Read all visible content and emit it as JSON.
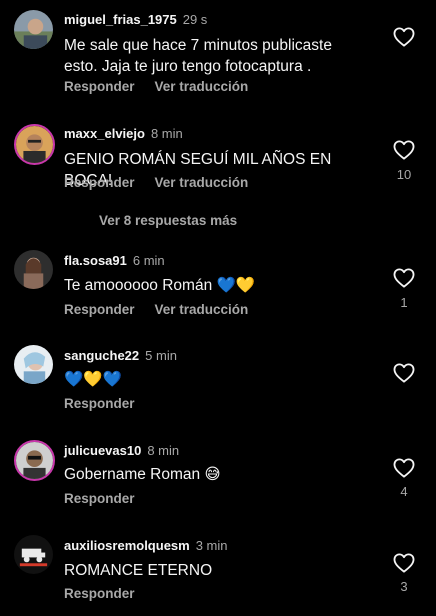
{
  "actions": {
    "reply_label": "Responder",
    "translate_label": "Ver traducción"
  },
  "comments": [
    {
      "username": "miguel_frias_1975",
      "time": "29 s",
      "text": "Me sale que hace 7 minutos publicaste esto. Jaja te juro tengo fotocaptura .",
      "likes": ""
    },
    {
      "username": "maxx_elviejo",
      "time": "8 min",
      "text": "GENIO ROMÁN SEGUÍ MIL AÑOS EN BOCA!",
      "likes": "10"
    },
    {
      "username": "fla.sosa91",
      "time": "6 min",
      "text": "Te amoooooo Román 💙💛",
      "likes": "1"
    },
    {
      "username": "sanguche22",
      "time": "5 min",
      "text": "💙💛💙",
      "likes": ""
    },
    {
      "username": "julicuevas10",
      "time": "8 min",
      "text": "Gobername Roman 😅",
      "likes": "4"
    },
    {
      "username": "auxiliosremolquesm",
      "time": "3 min",
      "text": "ROMANCE ETERNO",
      "likes": "3"
    }
  ],
  "more_replies_label": "Ver 8 respuestas más",
  "icons": {
    "like": "heart-outline-icon"
  },
  "colors": {
    "background": "#000000",
    "primary_text": "#f5f5f5",
    "secondary_text": "#a8a8a8"
  }
}
